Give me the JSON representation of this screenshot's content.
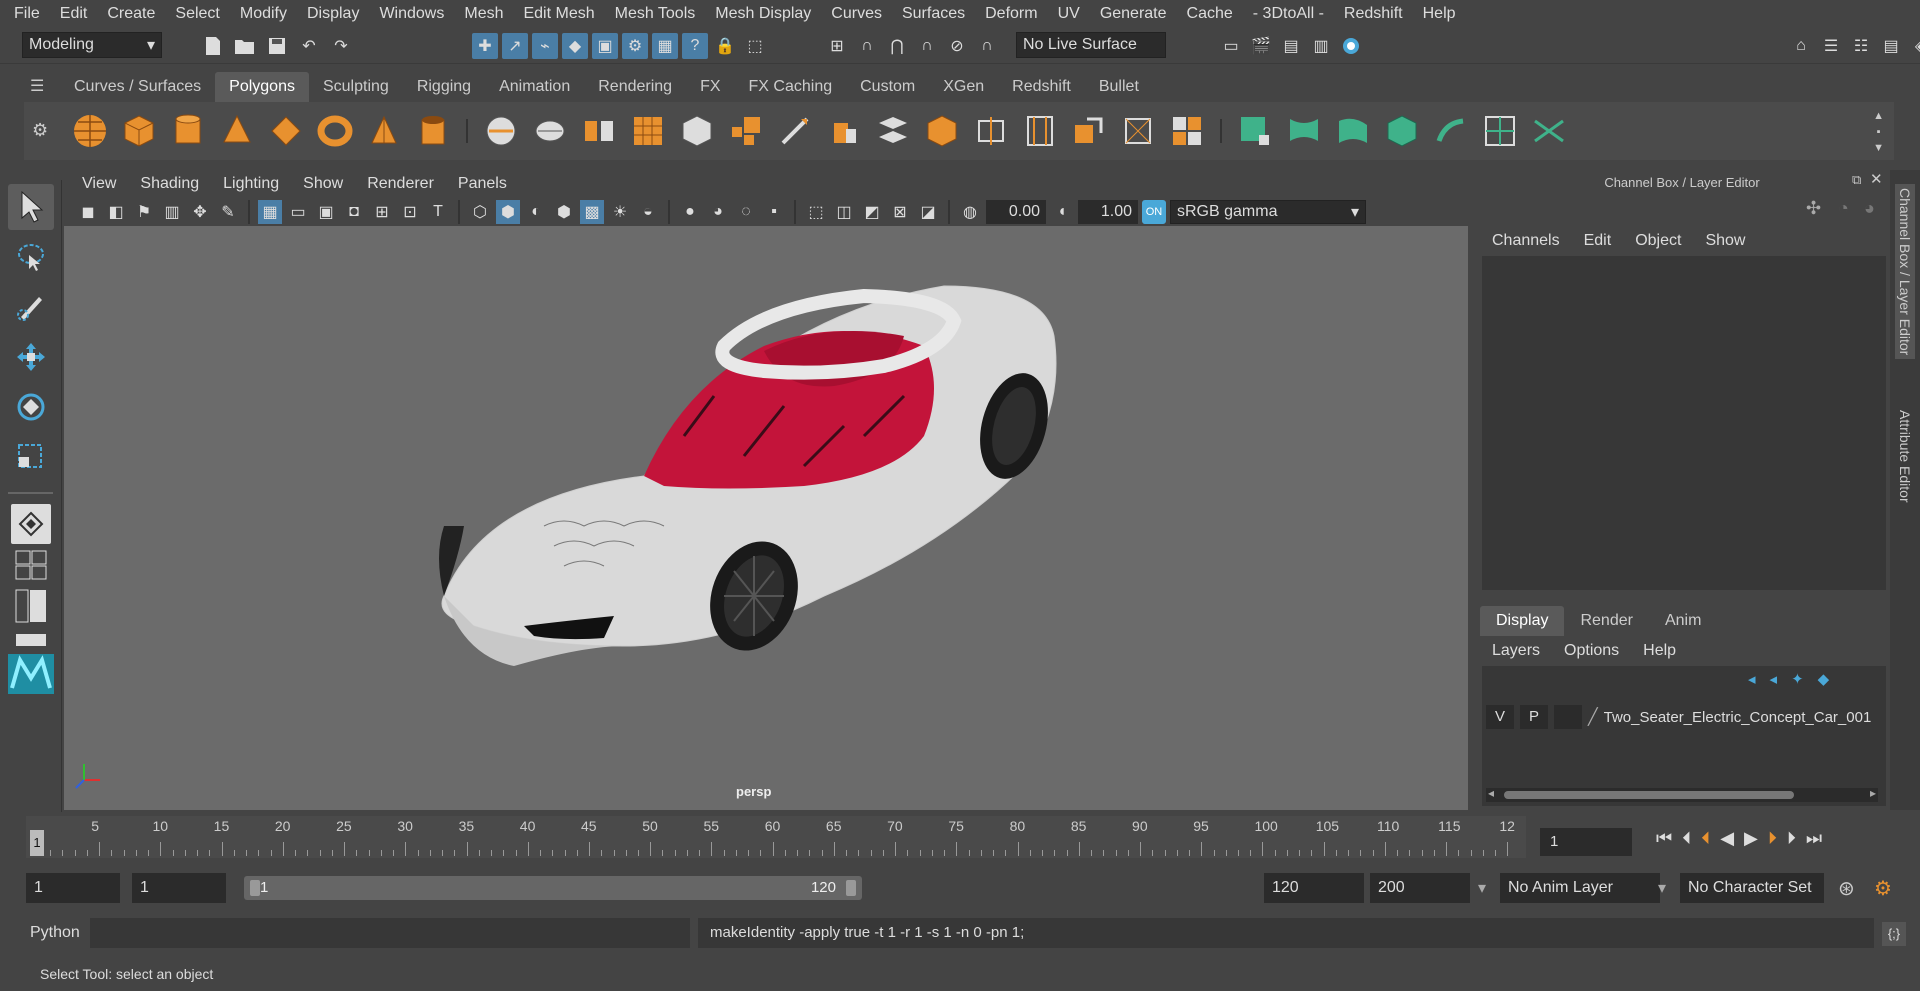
{
  "menubar": {
    "items": [
      "File",
      "Edit",
      "Create",
      "Select",
      "Modify",
      "Display",
      "Windows",
      "Mesh",
      "Edit Mesh",
      "Mesh Tools",
      "Mesh Display",
      "Curves",
      "Surfaces",
      "Deform",
      "UV",
      "Generate",
      "Cache",
      "- 3DtoAll -",
      "Redshift",
      "Help"
    ]
  },
  "statusline": {
    "mode": "Modeling",
    "live_surface": "No Live Surface"
  },
  "shelf": {
    "tabs": [
      "Curves / Surfaces",
      "Polygons",
      "Sculpting",
      "Rigging",
      "Animation",
      "Rendering",
      "FX",
      "FX Caching",
      "Custom",
      "XGen",
      "Redshift",
      "Bullet"
    ],
    "active_tab": "Polygons"
  },
  "viewport": {
    "menu": [
      "View",
      "Shading",
      "Lighting",
      "Show",
      "Renderer",
      "Panels"
    ],
    "exposure": "0.00",
    "gamma": "1.00",
    "color_space": "sRGB gamma",
    "camera_label": "persp"
  },
  "channel_box": {
    "title": "Channel Box / Layer Editor",
    "menu": [
      "Channels",
      "Edit",
      "Object",
      "Show"
    ]
  },
  "layer_editor": {
    "tabs": [
      "Display",
      "Render",
      "Anim"
    ],
    "active_tab": "Display",
    "menu": [
      "Layers",
      "Options",
      "Help"
    ],
    "layer": {
      "v": "V",
      "p": "P",
      "name": "Two_Seater_Electric_Concept_Car_001"
    }
  },
  "side_tabs": [
    "Channel Box / Layer Editor",
    "Attribute Editor"
  ],
  "timeline": {
    "ticks": [
      "5",
      "10",
      "15",
      "20",
      "25",
      "30",
      "35",
      "40",
      "45",
      "50",
      "55",
      "60",
      "65",
      "70",
      "75",
      "80",
      "85",
      "90",
      "95",
      "100",
      "105",
      "110",
      "115",
      "12"
    ],
    "current_frame_marker": "1",
    "current_frame": "1"
  },
  "range": {
    "start": "1",
    "playback_start": "1",
    "slider_start": "1",
    "slider_end": "120",
    "playback_end": "120",
    "end": "200",
    "anim_layer": "No Anim Layer",
    "character_set": "No Character Set"
  },
  "command_line": {
    "language": "Python",
    "result": "makeIdentity -apply true -t 1 -r 1 -s 1 -n 0 -pn 1;"
  },
  "help_line": "Select Tool: select an object",
  "colors": {
    "accent": "#4a7ea6",
    "bg": "#444444",
    "viewport": "#6b6b6b",
    "car_body": "#d9d9d9",
    "car_glass": "#c3143a",
    "poly_icon": "#e8912f",
    "teal_icon": "#3fb28a"
  }
}
